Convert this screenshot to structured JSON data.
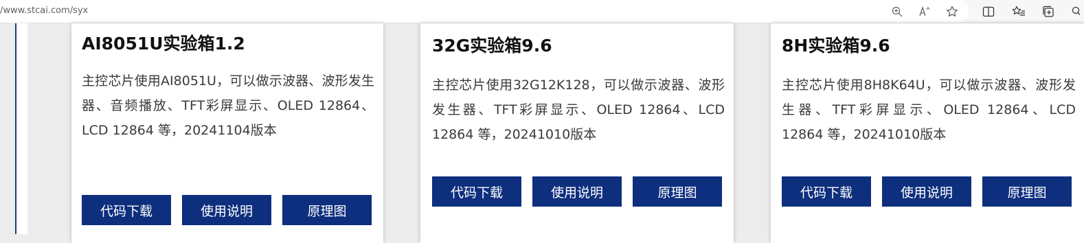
{
  "browser": {
    "url": "/www.stcai.com/syx",
    "icons": [
      "zoom-icon",
      "read-aloud-icon",
      "favorite-star-icon",
      "split-screen-icon",
      "favorites-icon",
      "collections-icon",
      "extensions-icon"
    ]
  },
  "cards": [
    {
      "title": "AI8051U实验箱1.2",
      "description": "主控芯片使用AI8051U，可以做示波器、波形发生器、音频播放、TFT彩屏显示、OLED 12864、LCD 12864 等，20241104版本",
      "buttons": [
        "代码下载",
        "使用说明",
        "原理图"
      ]
    },
    {
      "title": "32G实验箱9.6",
      "description": "主控芯片使用32G12K128，可以做示波器、波形发生器、TFT彩屏显示、OLED 12864、LCD 12864 等，20241010版本",
      "buttons": [
        "代码下载",
        "使用说明",
        "原理图"
      ]
    },
    {
      "title": "8H实验箱9.6",
      "description": "主控芯片使用8H8K64U，可以做示波器、波形发生器、TFT彩屏显示、OLED 12864、LCD 12864 等，20241010版本",
      "buttons": [
        "代码下载",
        "使用说明",
        "原理图"
      ]
    }
  ],
  "colors": {
    "button_bg": "#0e2f7e",
    "left_rule": "#1e3a7a"
  }
}
